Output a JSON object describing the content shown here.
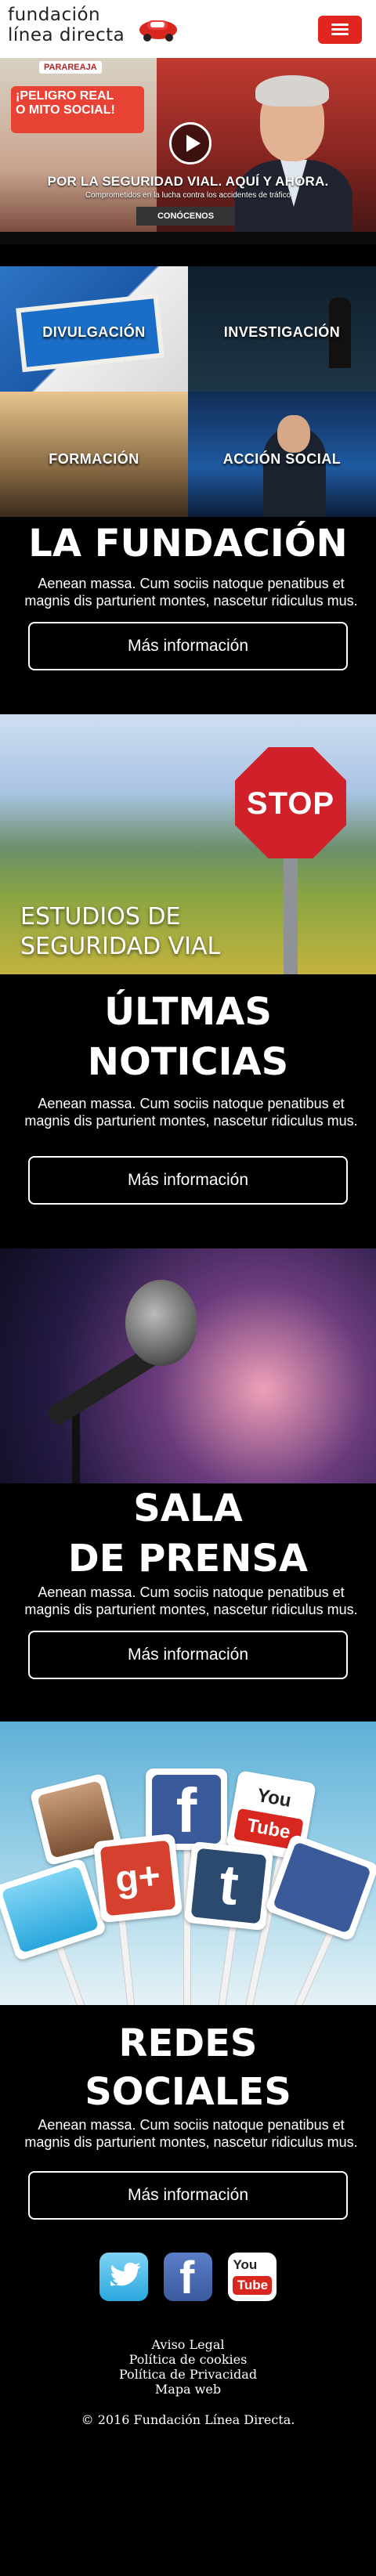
{
  "header": {
    "logo_line1": "fundación",
    "logo_line2": "línea directa",
    "menu_icon": "hamburger-icon",
    "menu_color": "#e0261e"
  },
  "hero": {
    "tag": "PARAREAJA",
    "sign_line1": "¡PELIGRO REAL",
    "sign_line2": "O MITO SOCIAL!",
    "title": "POR LA SEGURIDAD VIAL. AQUÍ Y AHORA.",
    "subtitle": "Comprometidos en la lucha contra los accidentes de tráfico",
    "cta": "CONÓCENOS",
    "play_icon": "play-icon"
  },
  "categories": [
    {
      "label": "DIVULGACIÓN"
    },
    {
      "label": "INVESTIGACIÓN"
    },
    {
      "label": "FORMACIÓN"
    },
    {
      "label": "ACCIÓN SOCIAL"
    }
  ],
  "fundacion": {
    "title": "LA FUNDACIÓN",
    "text": "Aenean massa. Cum sociis natoque penatibus et magnis dis parturient montes, nascetur ridiculus mus.",
    "button": "Más información"
  },
  "estudios": {
    "stop_text": "STOP",
    "caption_line1": "ESTUDIOS DE",
    "caption_line2": "SEGURIDAD VIAL"
  },
  "noticias": {
    "title_line1": "ÚLTMAS",
    "title_line2": "NOTICIAS",
    "text": "Aenean massa. Cum sociis natoque penatibus et magnis dis parturient montes, nascetur ridiculus mus.",
    "button": "Más información"
  },
  "prensa": {
    "title_line1": "SALA",
    "title_line2": "DE PRENSA",
    "text": "Aenean massa. Cum sociis natoque penatibus et magnis dis parturient montes, nascetur ridiculus mus.",
    "button": "Más información"
  },
  "redes": {
    "title_line1": "REDES",
    "title_line2": "SOCIALES",
    "text": "Aenean massa. Cum sociis natoque penatibus et magnis dis parturient montes, nascetur ridiculus mus.",
    "button": "Más información",
    "sign_labels": [
      "f",
      "g+",
      "t",
      "You",
      "Tube"
    ]
  },
  "footer": {
    "social": [
      {
        "name": "twitter",
        "icon": "twitter-icon"
      },
      {
        "name": "facebook",
        "icon": "facebook-icon",
        "glyph": "f"
      },
      {
        "name": "youtube",
        "icon": "youtube-icon",
        "you": "You",
        "tube": "Tube"
      }
    ],
    "links": [
      "Aviso Legal",
      "Política de cookies",
      "Política de Privacidad",
      "Mapa web"
    ],
    "copyright": "© 2016 Fundación Línea Directa."
  }
}
